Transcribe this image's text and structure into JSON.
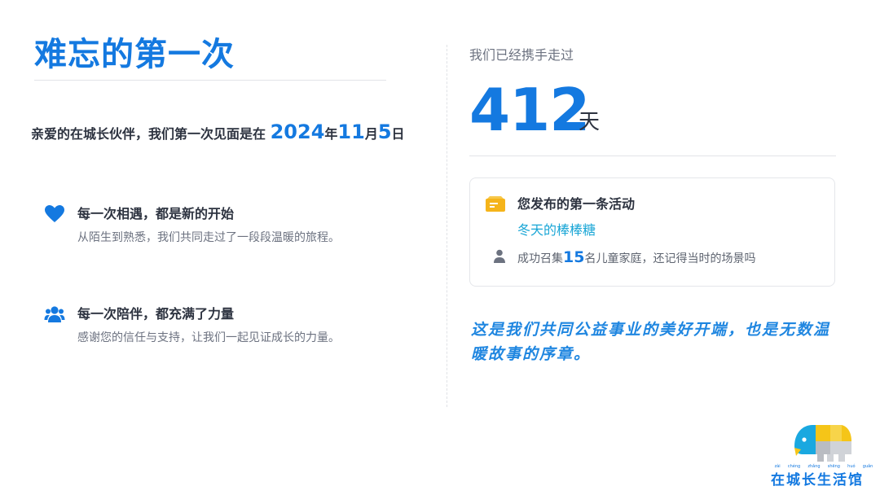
{
  "header": {
    "title": "难忘的第一次"
  },
  "intro": {
    "prefix": "亲爱的在城长伙伴，我们第一次见面是在",
    "year": "2024",
    "year_unit": "年",
    "month": "11",
    "month_unit": "月",
    "day": "5",
    "day_unit": "日"
  },
  "features": [
    {
      "icon": "heart-icon",
      "title": "每一次相遇，都是新的开始",
      "desc": "从陌生到熟悉，我们共同走过了一段段温暖的旅程。"
    },
    {
      "icon": "people-icon",
      "title": "每一次陪伴，都充满了力量",
      "desc": "感谢您的信任与支持，让我们一起见证成长的力量。"
    }
  ],
  "together": {
    "label": "我们已经携手走过",
    "days": "412",
    "unit": "天"
  },
  "activity_card": {
    "icon": "ticket-icon",
    "title": "您发布的第一条活动",
    "activity_name": "冬天的棒棒糖",
    "person_icon": "person-icon",
    "stat_prefix": "成功召集",
    "stat_count": "15",
    "stat_suffix": "名儿童家庭，还记得当时的场景吗"
  },
  "message": "这是我们共同公益事业的美好开端，也是无数温暖故事的序章。",
  "logo": {
    "pinyin": [
      "zài",
      "chéng",
      "zhǎng",
      "shēng",
      "huó",
      "guǎn"
    ],
    "text": "在城长生活馆"
  },
  "colors": {
    "accent": "#1479e0",
    "activity": "#19a6d6",
    "logo_yellow": "#f5c518",
    "logo_blue": "#1aa8e0"
  }
}
